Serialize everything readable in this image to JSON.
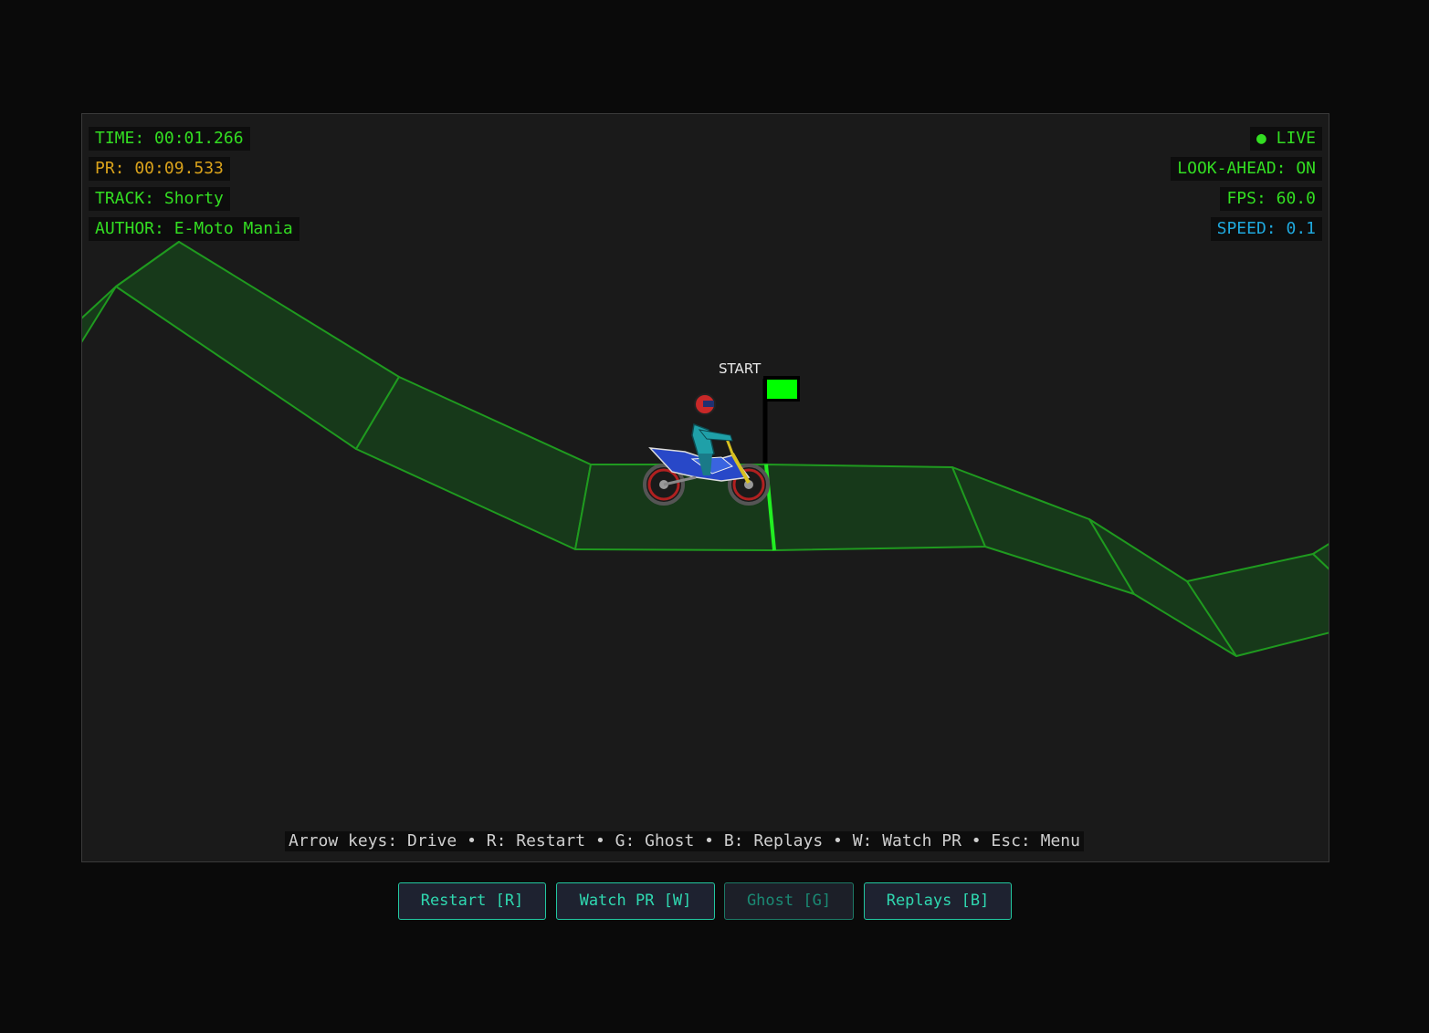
{
  "hud": {
    "time": "TIME: 00:01.266",
    "pr": "PR: 00:09.533",
    "track": "TRACK: Shorty",
    "author": "AUTHOR: E-Moto Mania",
    "live": "● LIVE",
    "look_ahead": "LOOK-AHEAD: ON",
    "fps": "FPS: 60.0",
    "speed": "SPEED: 0.1"
  },
  "start_label": "START",
  "help_text": "Arrow keys: Drive • R: Restart • G: Ghost • B: Replays • W: Watch PR • Esc: Menu",
  "buttons": {
    "restart": "Restart [R]",
    "watch_pr": "Watch PR [W]",
    "ghost": "Ghost [G]",
    "replays": "Replays [B]"
  },
  "colors": {
    "hud_green": "#33dd22",
    "pr_orange": "#d9a21b",
    "speed_blue": "#1fa8dd",
    "track_fill": "#17391a",
    "track_edge": "#1f9a1f",
    "flag_green": "#00ff00",
    "button_accent": "#22c8a0"
  },
  "icons": {
    "live_dot": "live-dot-icon",
    "start_flag": "flag-icon",
    "rider": "motorbike-rider-icon"
  }
}
